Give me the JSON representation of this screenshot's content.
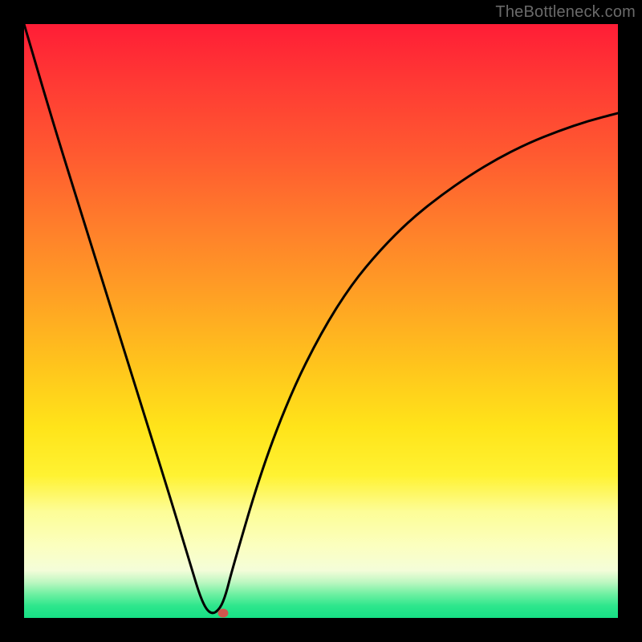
{
  "watermark": "TheBottleneck.com",
  "colors": {
    "frame": "#000000",
    "curve": "#000000",
    "marker": "#d1564e"
  },
  "chart_data": {
    "type": "line",
    "title": "",
    "xlabel": "",
    "ylabel": "",
    "xlim": [
      0,
      100
    ],
    "ylim": [
      0,
      100
    ],
    "x": [
      0,
      5,
      10,
      15,
      20,
      25,
      28,
      30,
      31.5,
      33,
      34,
      35,
      40,
      45,
      50,
      55,
      60,
      65,
      70,
      75,
      80,
      85,
      90,
      95,
      100
    ],
    "values": [
      100,
      83,
      67,
      51,
      35,
      19,
      9,
      2.5,
      0.5,
      1.5,
      4,
      8,
      25,
      38,
      48,
      56,
      62,
      67,
      71,
      74.5,
      77.5,
      80,
      82,
      83.7,
      85
    ],
    "minimum_x": 31.5,
    "minimum_y": 0.5,
    "marker": {
      "x": 33.5,
      "y": 0.8
    }
  }
}
